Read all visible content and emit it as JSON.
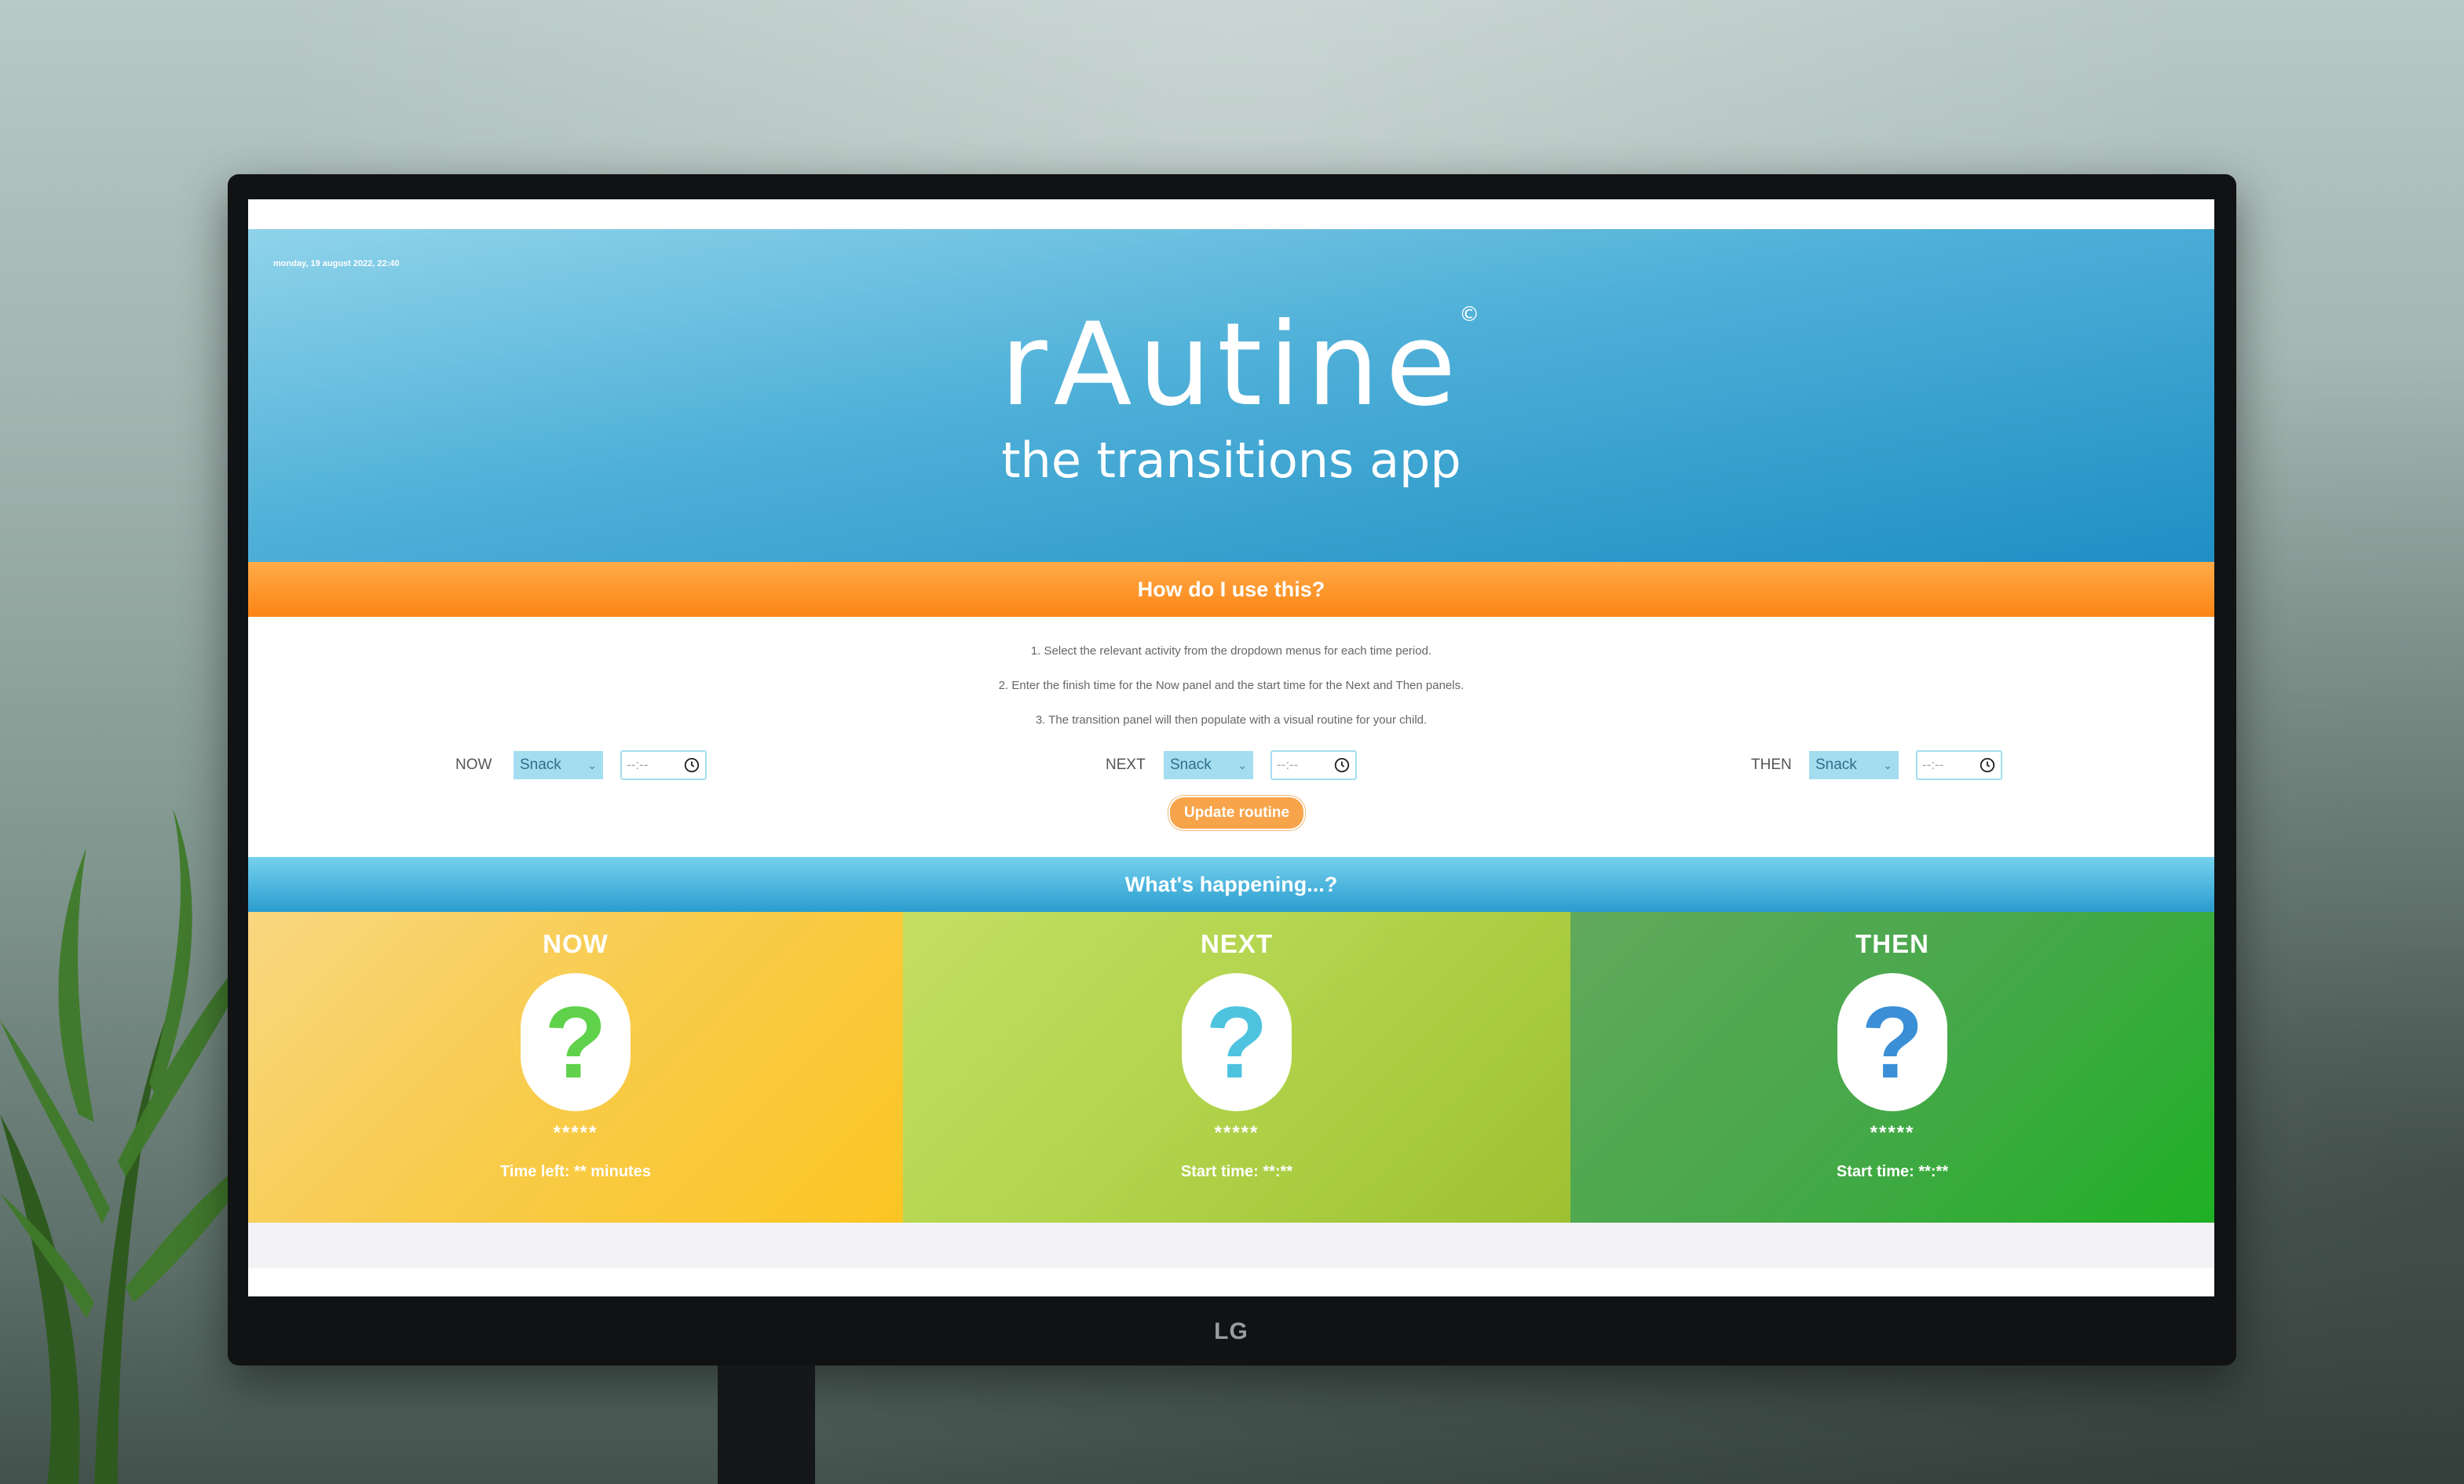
{
  "app": {
    "datetime": "monday, 19 august 2022, 22:40",
    "logo": "rAutine",
    "copyright_symbol": "©",
    "tagline": "the transitions app"
  },
  "help_bar": {
    "label": "How do I use this?"
  },
  "instructions": [
    "1. Select the relevant activity from the dropdown menus for each time period.",
    "2. Enter the finish time for the Now panel and the start time for the Next and Then panels.",
    "3. The transition panel will then populate with a visual routine for your child."
  ],
  "controls": [
    {
      "label": "NOW",
      "activity": "Snack",
      "time_placeholder": "--:--"
    },
    {
      "label": "NEXT",
      "activity": "Snack",
      "time_placeholder": "--:--"
    },
    {
      "label": "THEN",
      "activity": "Snack",
      "time_placeholder": "--:--"
    }
  ],
  "update_button": {
    "label": "Update routine"
  },
  "happening_bar": {
    "label": "What's happening...?"
  },
  "panels": [
    {
      "title": "NOW",
      "symbol": "?",
      "stars": "*****",
      "status": "Time left: ** minutes",
      "symbol_color": "#5fd14a"
    },
    {
      "title": "NEXT",
      "symbol": "?",
      "stars": "*****",
      "status": "Start time: **:**",
      "symbol_color": "#4ec3df"
    },
    {
      "title": "THEN",
      "symbol": "?",
      "stars": "*****",
      "status": "Start time: **:**",
      "symbol_color": "#3a8fd6"
    }
  ],
  "monitor": {
    "brand": "LG"
  }
}
